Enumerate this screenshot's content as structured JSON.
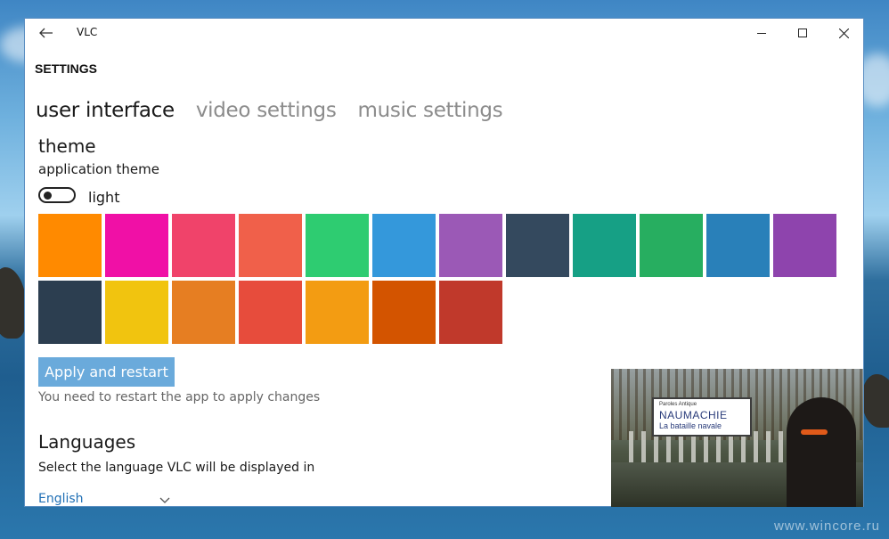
{
  "window": {
    "title": "VLC"
  },
  "page": {
    "heading": "SETTINGS"
  },
  "tabs": [
    {
      "label": "user interface",
      "active": true
    },
    {
      "label": "video settings",
      "active": false
    },
    {
      "label": "music settings",
      "active": false
    }
  ],
  "theme": {
    "section_title": "theme",
    "app_theme_label": "application theme",
    "toggle_state": "off",
    "toggle_label": "light",
    "colors": [
      "#ff8a00",
      "#f010a6",
      "#f0436a",
      "#f0604a",
      "#2ecc71",
      "#3498db",
      "#9b59b6",
      "#34495e",
      "#16a085",
      "#27ae60",
      "#2980b9",
      "#8e44ad",
      "#2c3e50",
      "#f1c40f",
      "#e67e22",
      "#e74c3c",
      "#f39c12",
      "#d35400",
      "#c0392b"
    ]
  },
  "apply": {
    "button_label": "Apply and restart",
    "hint": "You need to restart the app to apply changes"
  },
  "languages": {
    "section_title": "Languages",
    "description": "Select the language VLC will be displayed in",
    "selected": "English"
  },
  "video_preview": {
    "sign_small": "Paroles Antique",
    "sign_title": "NAUMACHIE",
    "sign_subtitle": "La bataille navale"
  },
  "desktop": {
    "watermark": "www.wincore.ru"
  }
}
